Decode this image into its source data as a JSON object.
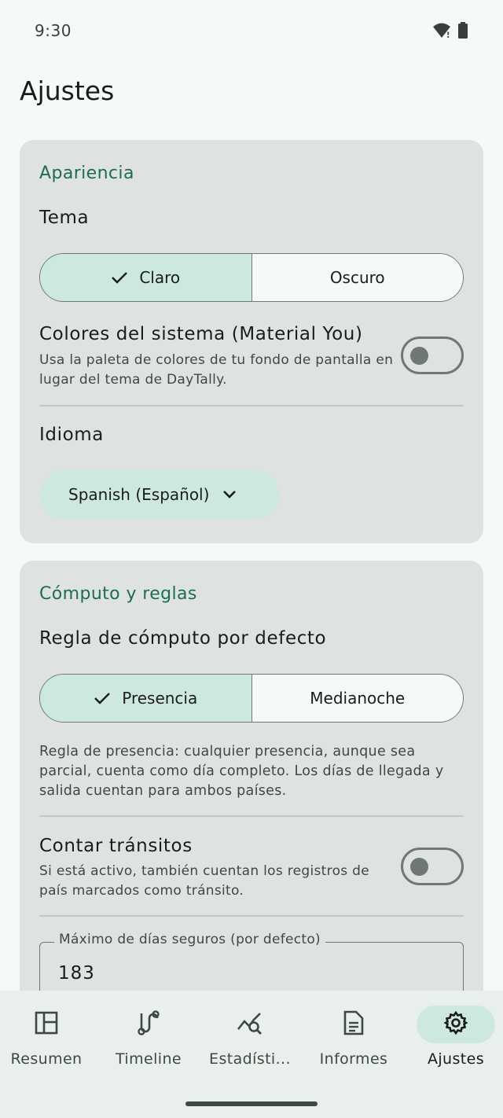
{
  "status_bar": {
    "time": "9:30"
  },
  "page_title": "Ajustes",
  "appearance": {
    "section_title": "Apariencia",
    "theme_label": "Tema",
    "theme_options": [
      "Claro",
      "Oscuro"
    ],
    "theme_selected": "Claro",
    "system_colors": {
      "title": "Colores del sistema (Material You)",
      "description": "Usa la paleta de colores de tu fondo de pantalla en lugar del tema de DayTally.",
      "enabled": false
    },
    "language_label": "Idioma",
    "language_value": "Spanish (Español)"
  },
  "computation": {
    "section_title": "Cómputo y reglas",
    "rule_label": "Regla de cómputo por defecto",
    "rule_options": [
      "Presencia",
      "Medianoche"
    ],
    "rule_selected": "Presencia",
    "rule_description": "Regla de presencia: cualquier presencia, aunque sea parcial, cuenta como día completo. Los días de llegada y salida cuentan para ambos países.",
    "transits": {
      "title": "Contar tránsitos",
      "description": "Si está activo, también cuentan los registros de país marcados como tránsito.",
      "enabled": false
    },
    "max_days": {
      "label": "Máximo de días seguros (por defecto)",
      "value": "183"
    }
  },
  "bottom_nav": {
    "items": [
      {
        "label": "Resumen",
        "icon": "dashboard-icon"
      },
      {
        "label": "Timeline",
        "icon": "route-icon"
      },
      {
        "label": "Estadísti...",
        "icon": "query-stats-icon"
      },
      {
        "label": "Informes",
        "icon": "document-icon"
      },
      {
        "label": "Ajustes",
        "icon": "gear-icon"
      }
    ],
    "active": "Ajustes"
  },
  "colors": {
    "background": "#f4faf6",
    "card": "#dee3e0",
    "accent": "#1e6b58",
    "selected_container": "#cde8dd",
    "outline": "#6f7873"
  }
}
